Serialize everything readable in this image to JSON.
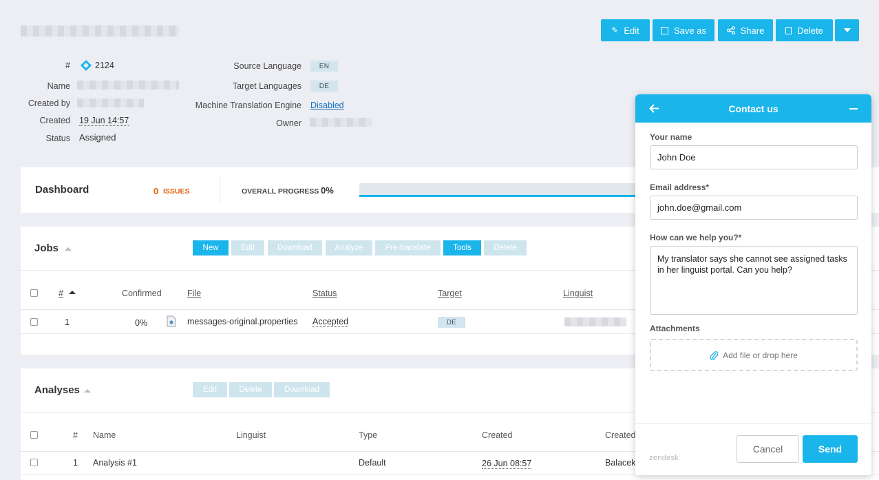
{
  "toolbar": {
    "edit": "Edit",
    "save_as": "Save as",
    "share": "Share",
    "delete": "Delete"
  },
  "details": {
    "id_label": "#",
    "id_value": "2124",
    "name_label": "Name",
    "created_by_label": "Created by",
    "created_label": "Created",
    "created_value": "19 Jun 14:57",
    "status_label": "Status",
    "status_value": "Assigned",
    "source_language_label": "Source Language",
    "source_language_value": "EN",
    "target_languages_label": "Target Languages",
    "target_languages_value": "DE",
    "mt_engine_label": "Machine Translation Engine",
    "mt_engine_value": "Disabled",
    "owner_label": "Owner"
  },
  "dashboard": {
    "title": "Dashboard",
    "issues_count": "0",
    "issues_label": "ISSUES",
    "progress_label": "OVERALL PROGRESS",
    "progress_value": "0%",
    "progress_fraction": 0
  },
  "jobs": {
    "title": "Jobs",
    "buttons": [
      "New",
      "Edit",
      "Download",
      "Analyze",
      "Pre-translate",
      "Tools",
      "Delete"
    ],
    "columns": {
      "num": "#",
      "confirmed": "Confirmed",
      "file": "File",
      "status": "Status",
      "target": "Target",
      "linguist": "Linguist"
    },
    "rows": [
      {
        "num": "1",
        "confirmed": "0%",
        "file": "messages-original.properties",
        "status": "Accepted",
        "target": "DE"
      }
    ]
  },
  "analyses": {
    "title": "Analyses",
    "buttons": [
      "Edit",
      "Delete",
      "Download"
    ],
    "columns": {
      "num": "#",
      "name": "Name",
      "linguist": "Linguist",
      "type": "Type",
      "created": "Created",
      "created_by": "Created"
    },
    "rows": [
      {
        "num": "1",
        "name": "Analysis #1",
        "type": "Default",
        "created": "26 Jun 08:57",
        "created_by": "Balacek"
      }
    ]
  },
  "contact": {
    "title": "Contact us",
    "name_label": "Your name",
    "name_value": "John Doe",
    "email_label": "Email address*",
    "email_value": "john.doe@gmail.com",
    "help_label": "How can we help you?*",
    "help_value": "My translator says she cannot see assigned tasks in her linguist portal. Can you help?",
    "attachments_label": "Attachments",
    "attachments_hint": "Add file or drop here",
    "cancel": "Cancel",
    "send": "Send",
    "brand": "zendesk"
  },
  "colors": {
    "accent": "#1ab5ea",
    "issues": "#e0620c"
  }
}
